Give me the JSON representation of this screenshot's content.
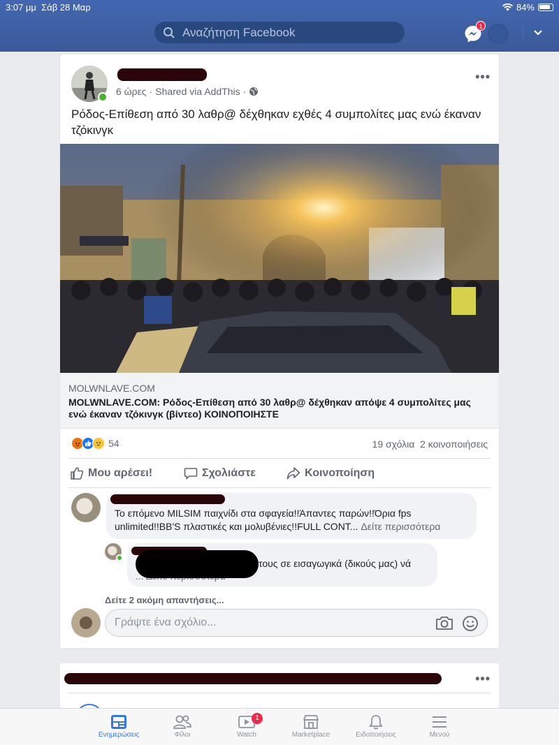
{
  "status_bar": {
    "time": "3:07 μμ",
    "date": "Σάβ 28 Μαρ",
    "battery": "84%"
  },
  "header": {
    "search_placeholder": "Αναζήτηση Facebook",
    "messenger_badge": "1"
  },
  "post": {
    "meta_time": "6 ώρες",
    "meta_shared": "Shared via AddThis",
    "text": "Ρόδος-Επίθεση από 30 λαθρ@ δέχθηκαν εχθές 4 συμπολίτες μας ενώ έκαναν τζόκινγκ",
    "link": {
      "domain": "MOLWNLAVE.COM",
      "title": "MOLWNLAVE.COM: Ρόδος-Επίθεση από 30 λαθρ@ δέχθηκαν απόψε 4 συμπολίτες μας ενώ έκαναν τζόκινγκ (βίντεο) ΚΟΙΝΟΠΟΙΗΣΤΕ"
    },
    "reaction_count": "54",
    "comments_count": "19 σχόλια",
    "shares_count": "2 κοινοποιήσεις",
    "actions": {
      "like": "Μου αρέσει!",
      "comment": "Σχολιάστε",
      "share": "Κοινοποίηση"
    }
  },
  "comments": [
    {
      "text": "Το επόμενο MILSIM παιχνίδι στα σφαγεία!!Άπαντες παρών!!Όρια fps unlimited!!BB'S πλαστικές και μολυβένιες!!FULL CONT...",
      "see_more": "Δείτε περισσότερα"
    },
    {
      "text_visible": "τους σε εισαγωγικά (δικούς μας) νά",
      "line2": "... Δείτε περισσότερα"
    }
  ],
  "more_replies": "Δείτε 2 ακόμη απαντήσεις...",
  "comment_input_placeholder": "Γράψτε ένα σχόλιο...",
  "bottom_nav": [
    {
      "label": "Ενημερώσεις",
      "icon": "news-feed-icon",
      "active": true
    },
    {
      "label": "Φίλοι",
      "icon": "friends-icon"
    },
    {
      "label": "Watch",
      "icon": "watch-icon",
      "badge": "1"
    },
    {
      "label": "Marketplace",
      "icon": "marketplace-icon"
    },
    {
      "label": "Ειδοποιήσεις",
      "icon": "bell-icon"
    },
    {
      "label": "Μενού",
      "icon": "menu-icon"
    }
  ],
  "colors": {
    "brand": "#3b5998",
    "accent": "#3578e5",
    "online": "#42b72a",
    "badge": "#f02849"
  }
}
